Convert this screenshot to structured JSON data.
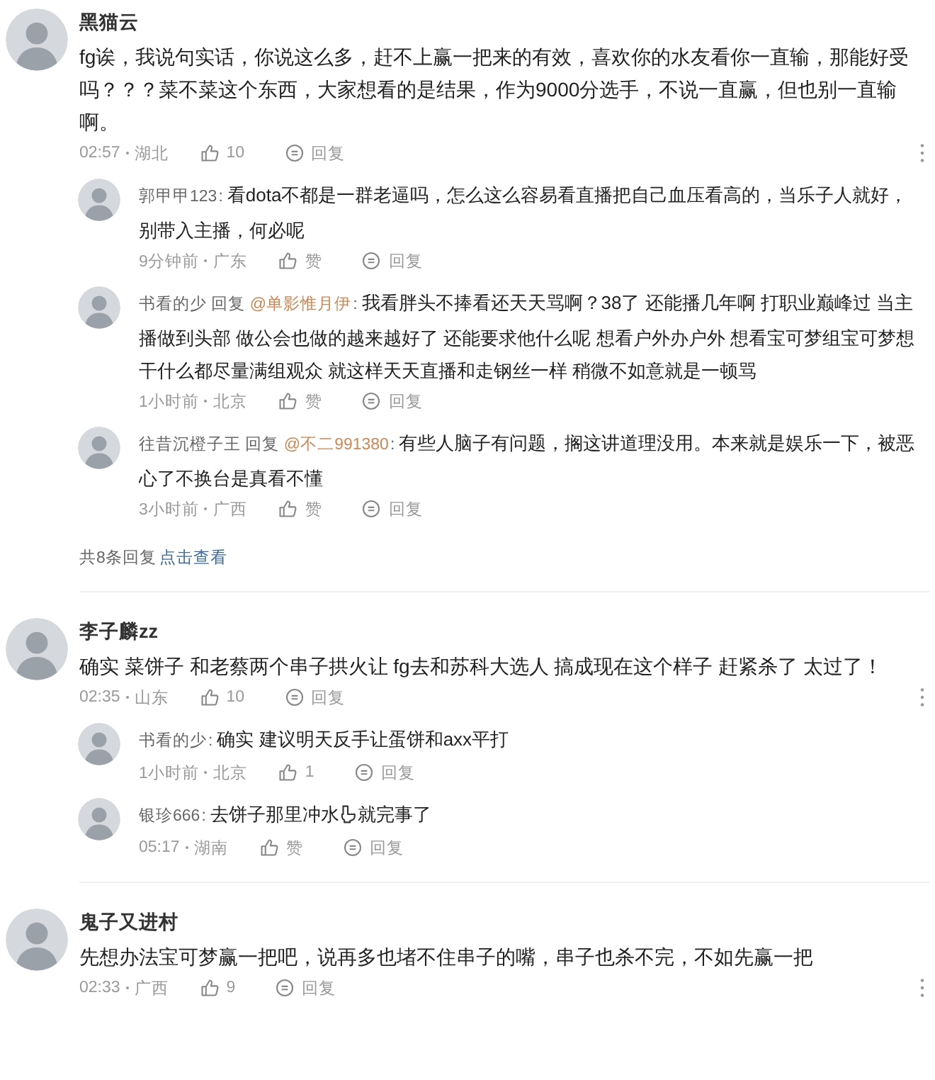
{
  "comments": [
    {
      "author": "黑猫云",
      "text": "fg诶，我说句实话，你说这么多，赶不上赢一把来的有效，喜欢你的水友看你一直输，那能好受吗？？？菜不菜这个东西，大家想看的是结果，作为9000分选手，不说一直赢，但也别一直输啊。",
      "time": "02:57",
      "location": "湖北",
      "likes": "10",
      "reply_label": "回复",
      "replies": [
        {
          "author": "郭甲甲123",
          "colon": ":",
          "segments": [
            {
              "kind": "text",
              "text": "看dota不都是一群老逼吗，怎么这么容易看直播把自己血压看高的，当乐子人就好，别带入主播，何必呢"
            }
          ],
          "time": "9分钟前",
          "location": "广东",
          "likes": "赞",
          "reply_label": "回复"
        },
        {
          "author": "书看的少",
          "reply_word": "回复",
          "reply_to": "@单影惟月伊",
          "colon": ":",
          "segments": [
            {
              "kind": "text",
              "text": "我看胖头不捧看还天天骂啊？38了 还能播几年啊 打职业巅峰过 当主播做到头部 做公会也做的越来越好了 还能要求他什么呢 想看户外办户外 想看宝可梦组宝可梦想干什么都尽量满组观众 就这样天天直播和走钢丝一样 稍微不如意就是一顿骂"
            }
          ],
          "time": "1小时前",
          "location": "北京",
          "likes": "赞",
          "reply_label": "回复"
        },
        {
          "author": "往昔沉橙子王",
          "reply_word": "回复",
          "reply_to": "@不二991380",
          "colon": ":",
          "segments": [
            {
              "kind": "text",
              "text": "有些人脑子有问题，搁这讲道理没用。本来就是娱乐一下，被恶心了不换台是真看不懂"
            }
          ],
          "time": "3小时前",
          "location": "广西",
          "likes": "赞",
          "reply_label": "回复"
        }
      ],
      "more": {
        "count": "共8条回复",
        "link": "点击查看"
      }
    },
    {
      "author": "李子麟zz",
      "text": "确实 菜饼子 和老蔡两个串子拱火让 fg去和苏科大选人 搞成现在这个样子 赶紧杀了 太过了！",
      "time": "02:35",
      "location": "山东",
      "likes": "10",
      "reply_label": "回复",
      "replies": [
        {
          "author": "书看的少",
          "colon": ":",
          "segments": [
            {
              "kind": "text",
              "text": "确实 建议明天反手让蛋饼和axx平打"
            }
          ],
          "time": "1小时前",
          "location": "北京",
          "likes": "1",
          "reply_label": "回复"
        },
        {
          "author": "银珍666",
          "colon": ":",
          "segments": [
            {
              "kind": "text",
              "text": "去饼子那里冲水"
            },
            {
              "kind": "toilet"
            },
            {
              "kind": "text",
              "text": "就完事了"
            }
          ],
          "time": "05:17",
          "location": "湖南",
          "likes": "赞",
          "reply_label": "回复"
        }
      ]
    },
    {
      "author": "鬼子又进村",
      "text": "先想办法宝可梦赢一把吧，说再多也堵不住串子的嘴，串子也杀不完，不如先赢一把",
      "time": "02:33",
      "location": "广西",
      "likes": "9",
      "reply_label": "回复"
    }
  ]
}
